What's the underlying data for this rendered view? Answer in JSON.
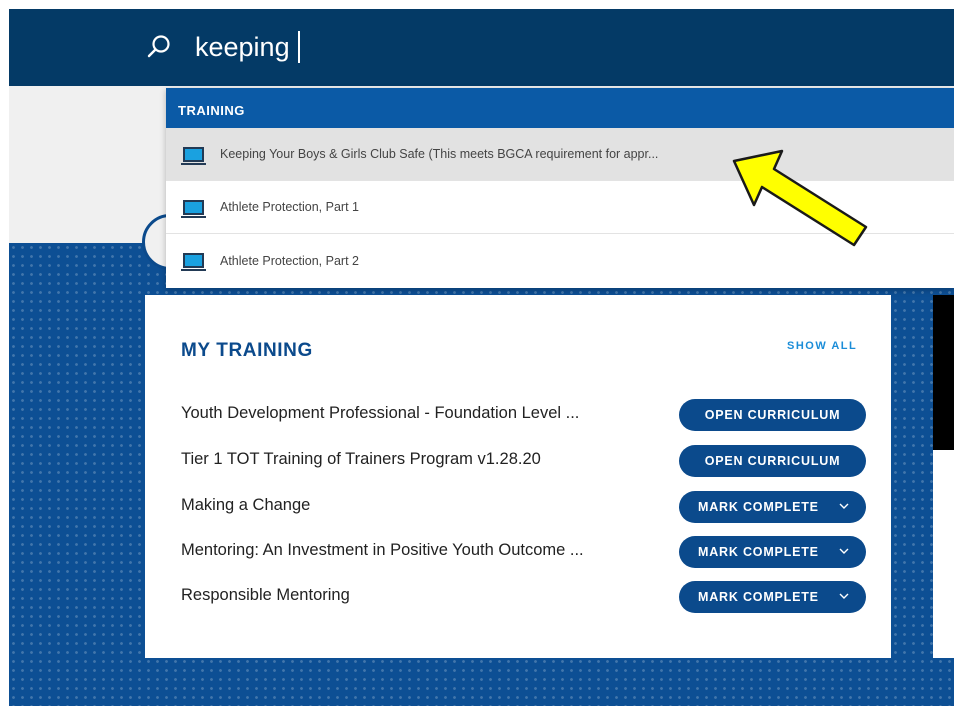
{
  "search": {
    "query": "keeping",
    "placeholder": ""
  },
  "dropdown": {
    "section_label": "TRAINING",
    "results": [
      {
        "label": "Keeping Your Boys & Girls Club Safe (This meets BGCA requirement for appr...",
        "icon": "monitor-icon",
        "highlighted": true
      },
      {
        "label": "Athlete Protection, Part 1",
        "icon": "monitor-icon",
        "highlighted": false
      },
      {
        "label": "Athlete Protection, Part 2",
        "icon": "monitor-icon",
        "highlighted": false
      }
    ]
  },
  "my_training": {
    "title": "MY TRAINING",
    "show_all": "SHOW ALL",
    "items": [
      {
        "name": "Youth Development Professional - Foundation Level ...",
        "action": "OPEN CURRICULUM",
        "has_menu": false
      },
      {
        "name": "Tier 1 TOT Training of Trainers Program v1.28.20",
        "action": "OPEN CURRICULUM",
        "has_menu": false
      },
      {
        "name": "Making a Change",
        "action": "MARK COMPLETE",
        "has_menu": true
      },
      {
        "name": "Mentoring: An Investment in Positive Youth Outcome ...",
        "action": "MARK COMPLETE",
        "has_menu": true
      },
      {
        "name": "Responsible Mentoring",
        "action": "MARK COMPLETE",
        "has_menu": true
      }
    ]
  },
  "colors": {
    "topbar": "#043a66",
    "brand_blue": "#0b4a8c",
    "dropdown_header": "#0b5aa6",
    "link_blue": "#1b8dd8",
    "arrow_fill": "#ffff00"
  }
}
